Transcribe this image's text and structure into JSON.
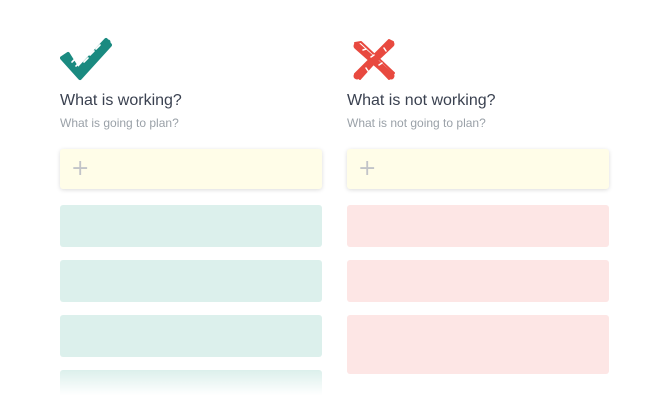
{
  "board": {
    "columns": [
      {
        "icon": "checkmark-icon",
        "icon_color": "#1a8a80",
        "title": "What is working?",
        "subtitle": "What is going to plan?",
        "add_icon": "plus-icon",
        "add_color": "#fffde8",
        "card_color": "#dcf0ec",
        "card_count": 4
      },
      {
        "icon": "cross-icon",
        "icon_color": "#e8493f",
        "title": "What is not working?",
        "subtitle": "What is not going to plan?",
        "add_icon": "plus-icon",
        "add_color": "#fffde8",
        "card_color": "#fde6e5",
        "card_count": 3
      }
    ]
  }
}
